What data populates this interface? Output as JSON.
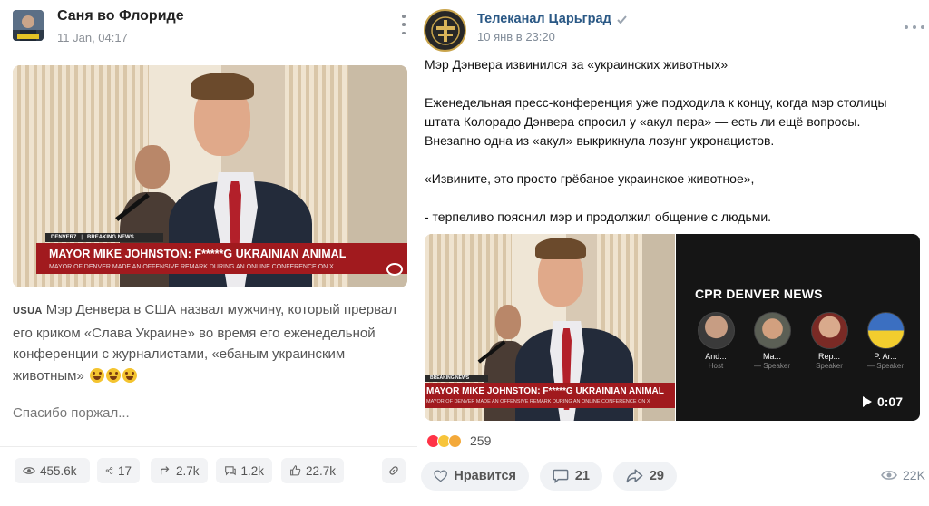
{
  "left_post": {
    "author": "Саня во Флориде",
    "date": "11 Jan, 04:17",
    "image_overlay": {
      "channel": "DENVER7",
      "breaking": "BREAKING NEWS",
      "headline": "MAYOR MIKE JOHNSTON: F*****G UKRAINIAN ANIMAL",
      "subline": "MAYOR OF DENVER MADE AN OFFENSIVE REMARK DURING AN ONLINE CONFERENCE ON X"
    },
    "text_tag": "USUA",
    "text": "Мэр Денвера в США назвал мужчину, который прервал его криком «Слава Украине» во время его еженедельной конференции с журналистами, «ебаным украинским животным»",
    "text_second": "Спасибо поржал...",
    "stats": {
      "views": "455.6k",
      "shares": "17",
      "reposts": "2.7k",
      "comments": "1.2k",
      "likes": "22.7k"
    }
  },
  "right_post": {
    "author": "Телеканал Царьград",
    "date": "10 янв в 23:20",
    "paragraphs": [
      "Мэр Дэнвера извинился за «украинских животных»",
      "Еженедельная пресс-конференция уже подходила к концу, когда мэр столицы штата Колорадо Дэнвера спросил у «акул пера» — есть ли ещё вопросы. Внезапно одна из «акул» выкрикнула лозунг укронацистов.",
      "«Извините, это просто грёбаное украинское животное»,",
      "- терпеливо пояснил мэр и продолжил общение с людьми."
    ],
    "image_overlay": {
      "breaking": "BREAKING NEWS",
      "headline": "MAYOR MIKE JOHNSTON: F*****G UKRAINIAN ANIMAL",
      "subline": "MAYOR OF DENVER MADE AN OFFENSIVE REMARK DURING AN ONLINE CONFERENCE ON X"
    },
    "video": {
      "title": "CPR DENVER NEWS",
      "speakers": [
        {
          "name": "And...",
          "role": "Host"
        },
        {
          "name": "Ma...",
          "role": "— Speaker"
        },
        {
          "name": "Rep...",
          "role": "Speaker"
        },
        {
          "name": "P. Ar...",
          "role": "— Speaker"
        }
      ],
      "duration": "0:07"
    },
    "reactions_count": "259",
    "buttons": {
      "like": "Нравится",
      "comments": "21",
      "shares": "29"
    },
    "views": "22K"
  },
  "colors": {
    "link_blue": "#2a5885",
    "banner_red": "#a11a1e",
    "verified": "#9aa4b0"
  }
}
